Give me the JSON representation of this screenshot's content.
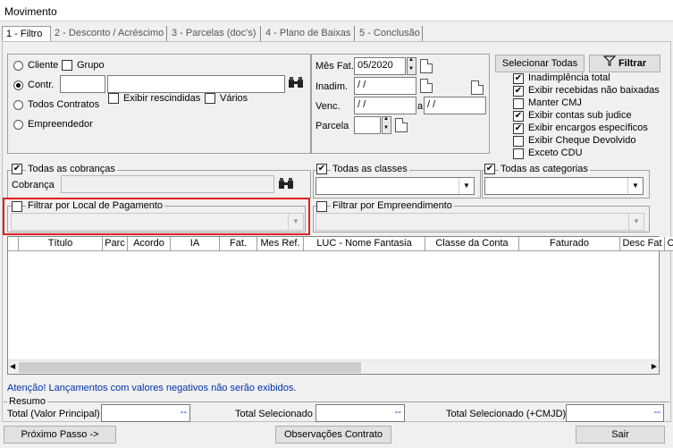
{
  "window": {
    "title": "Movimento"
  },
  "tabs": [
    {
      "label": "1 - Filtro"
    },
    {
      "label": "2 - Desconto / Acréscimo"
    },
    {
      "label": "3 - Parcelas (doc's)"
    },
    {
      "label": "4 - Plano de Baixas"
    },
    {
      "label": "5 - Conclusão"
    }
  ],
  "filters": {
    "cliente": "Cliente",
    "grupo": "Grupo",
    "contr": "Contr.",
    "exibir_rescindidas": "Exibir rescindidas",
    "varios": "Vários",
    "todos_contratos": "Todos Contratos",
    "empreendedor": "Empreendedor",
    "selected_radio": "Contr."
  },
  "dates": {
    "mes_fat_label": "Mês Fat.",
    "mes_fat_value": "05/2020",
    "inadim_label": "Inadim.",
    "inadim_value": " /  /",
    "venc_label": "Venc.",
    "venc_from": " /  /",
    "venc_sep": "a",
    "venc_to": " /  /",
    "parcela_label": "Parcela"
  },
  "options": {
    "selecionar_todas": "Selecionar Todas",
    "filtrar": "Filtrar",
    "items": [
      {
        "label": "Inadimplência total",
        "checked": true
      },
      {
        "label": "Exibir recebidas não baixadas",
        "checked": true
      },
      {
        "label": "Manter CMJ",
        "checked": false
      },
      {
        "label": "Exibir contas sub judice",
        "checked": true
      },
      {
        "label": "Exibir encargos específicos",
        "checked": true
      },
      {
        "label": "Exibir Cheque Devolvido",
        "checked": false
      },
      {
        "label": "Exceto CDU",
        "checked": false
      }
    ]
  },
  "groups": {
    "todas_cobrancas": "Todas as cobranças",
    "cobranca_label": "Cobrança",
    "todas_classes": "Todas as classes",
    "todas_categorias": "Todas as categorias",
    "local_pagamento": "Filtrar por Local de Pagamento",
    "empreendimento": "Filtrar por Empreendimento"
  },
  "grid": {
    "columns": [
      "Título",
      "Parc",
      "Acordo",
      "IA",
      "Fat.",
      "Mes Ref.",
      "LUC - Nome Fantasia",
      "Classe da Conta",
      "Faturado",
      "Desc Fat",
      "Co"
    ]
  },
  "warning": "Atenção! Lançamentos com valores negativos não serão exibidos.",
  "resumo": {
    "title": "Resumo",
    "total_principal_label": "Total (Valor Principal)",
    "total_principal_value": "--",
    "total_sel_label": "Total Selecionado",
    "total_sel_value": "--",
    "total_sel_cmjd_label": "Total Selecionado (+CMJD)",
    "total_sel_cmjd_value": "--"
  },
  "buttons": {
    "proximo": "Próximo Passo ->",
    "observacoes": "Observações Contrato",
    "sair": "Sair"
  },
  "colors": {
    "highlight": "#e02020",
    "warning_text": "#0033aa"
  }
}
